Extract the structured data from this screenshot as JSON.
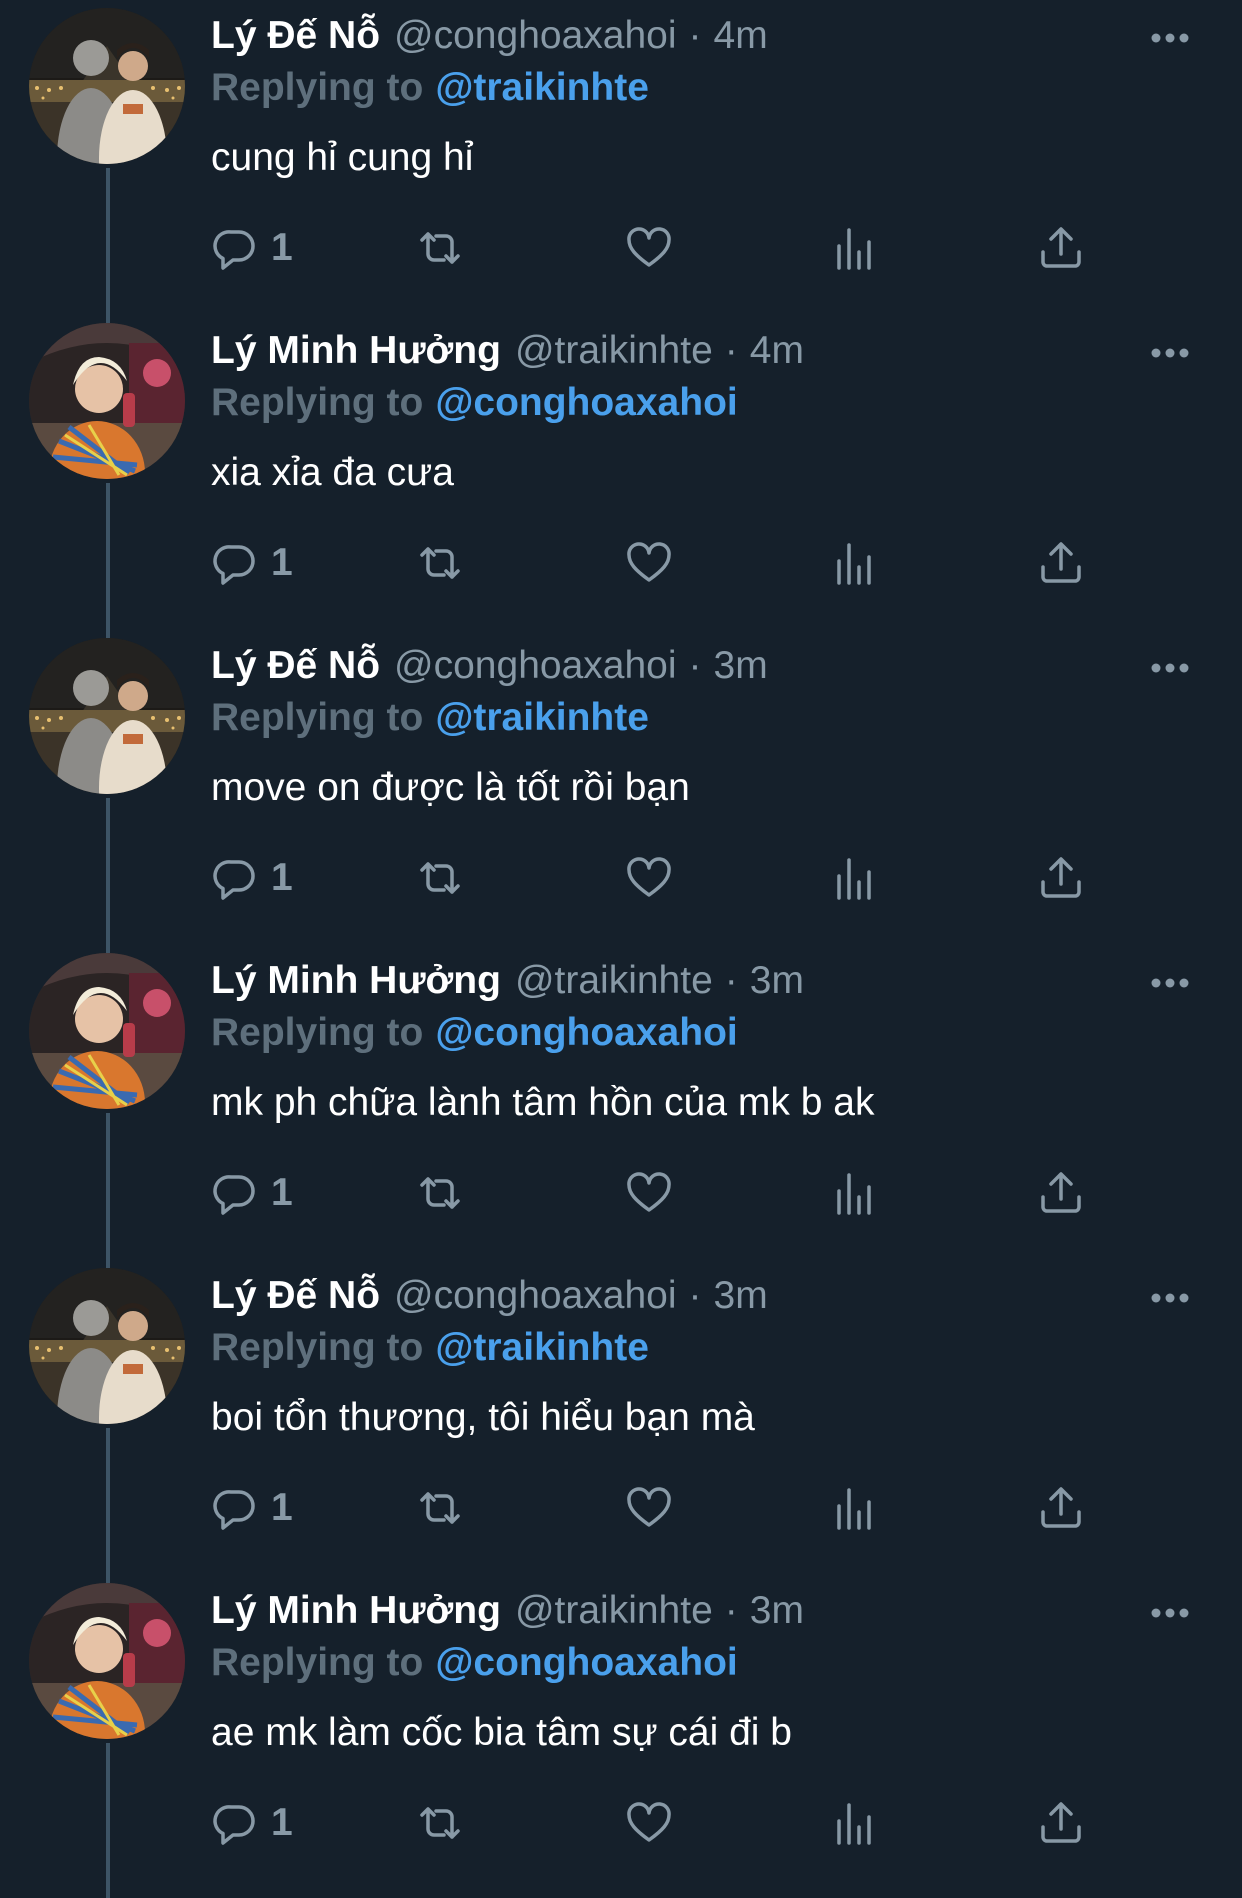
{
  "colors": {
    "background": "#15202b",
    "name": "#ffffff",
    "secondary_text": "#8899a6",
    "replying_text": "#5e6f7c",
    "mention": "#4aa0ec",
    "thread_line": "#3d5466"
  },
  "tweets": [
    {
      "name": "Lý Đế Nỗ",
      "handle": "@conghoaxahoi",
      "separator": "·",
      "time": "4m",
      "replying_label": "Replying to",
      "replying_to": "@traikinhte",
      "text": "cung hỉ cung hỉ",
      "reply_count": "1",
      "avatar": "avatar-ly-de-no"
    },
    {
      "name": "Lý Minh Hưởng",
      "handle": "@traikinhte",
      "separator": "·",
      "time": "4m",
      "replying_label": "Replying to",
      "replying_to": "@conghoaxahoi",
      "text": "xia xỉa đa cưa",
      "reply_count": "1",
      "avatar": "avatar-ly-minh-huong"
    },
    {
      "name": "Lý Đế Nỗ",
      "handle": "@conghoaxahoi",
      "separator": "·",
      "time": "3m",
      "replying_label": "Replying to",
      "replying_to": "@traikinhte",
      "text": "move on được là tốt rồi bạn",
      "reply_count": "1",
      "avatar": "avatar-ly-de-no"
    },
    {
      "name": "Lý Minh Hưởng",
      "handle": "@traikinhte",
      "separator": "·",
      "time": "3m",
      "replying_label": "Replying to",
      "replying_to": "@conghoaxahoi",
      "text": "mk ph chữa lành tâm hồn của mk b ak",
      "reply_count": "1",
      "avatar": "avatar-ly-minh-huong"
    },
    {
      "name": "Lý Đế Nỗ",
      "handle": "@conghoaxahoi",
      "separator": "·",
      "time": "3m",
      "replying_label": "Replying to",
      "replying_to": "@traikinhte",
      "text": "boi tổn thương, tôi hiểu bạn mà",
      "reply_count": "1",
      "avatar": "avatar-ly-de-no"
    },
    {
      "name": "Lý Minh Hưởng",
      "handle": "@traikinhte",
      "separator": "·",
      "time": "3m",
      "replying_label": "Replying to",
      "replying_to": "@conghoaxahoi",
      "text": "ae mk làm cốc bia tâm sự cái đi b",
      "reply_count": "1",
      "avatar": "avatar-ly-minh-huong"
    }
  ]
}
